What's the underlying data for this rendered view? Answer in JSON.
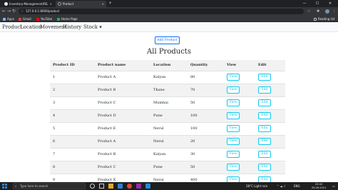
{
  "browser": {
    "tabs": [
      {
        "label": "Inventory-Management/README.m",
        "active": false
      },
      {
        "label": "Product",
        "active": true
      }
    ],
    "new_tab": "+",
    "window_controls": {
      "minimize": "—",
      "maximize": "☐",
      "close": "✕"
    },
    "address": "127.0.0.1:8000/product",
    "bookmarks": [
      {
        "label": "Apps",
        "color": "#8ab4f8"
      },
      {
        "label": "Gmail",
        "color": "#ea4335"
      },
      {
        "label": "YouTube",
        "color": "#ff0000"
      },
      {
        "label": "Home Page",
        "color": "#34a853"
      }
    ],
    "reading_list": "Reading list"
  },
  "nav": {
    "links": [
      "Product",
      "Location",
      "Movement",
      "History"
    ],
    "dropdown": "Stock ▾"
  },
  "main": {
    "add_button": "Add Product",
    "title": "All Products",
    "columns": [
      "Product ID",
      "Product name",
      "Location",
      "Quantity",
      "View",
      "Edit"
    ],
    "rows": [
      {
        "id": "1",
        "name": "Product A",
        "location": "Kalyan",
        "qty": "80"
      },
      {
        "id": "2",
        "name": "Product B",
        "location": "Thane",
        "qty": "70"
      },
      {
        "id": "3",
        "name": "Product C",
        "location": "Mumbai",
        "qty": "50"
      },
      {
        "id": "4",
        "name": "Product D",
        "location": "Pune",
        "qty": "100"
      },
      {
        "id": "5",
        "name": "Product E",
        "location": "Nerul",
        "qty": "100"
      },
      {
        "id": "6",
        "name": "Product A",
        "location": "Nerul",
        "qty": "20"
      },
      {
        "id": "7",
        "name": "Product B",
        "location": "Kalyan",
        "qty": "30"
      },
      {
        "id": "8",
        "name": "Product C",
        "location": "Pune",
        "qty": "50"
      },
      {
        "id": "9",
        "name": "Product X",
        "location": "Nerul",
        "qty": "400"
      }
    ],
    "view_label": "View",
    "edit_label": "Edit"
  },
  "taskbar": {
    "search_placeholder": "Type here to search",
    "weather": "28°C  Light rain",
    "language": "ENG",
    "time": "23:40",
    "date": "25-09-2021"
  },
  "colors": {
    "primary": "#0d6efd",
    "info": "#0dcaf0",
    "stripe": "#f2f2f2"
  }
}
